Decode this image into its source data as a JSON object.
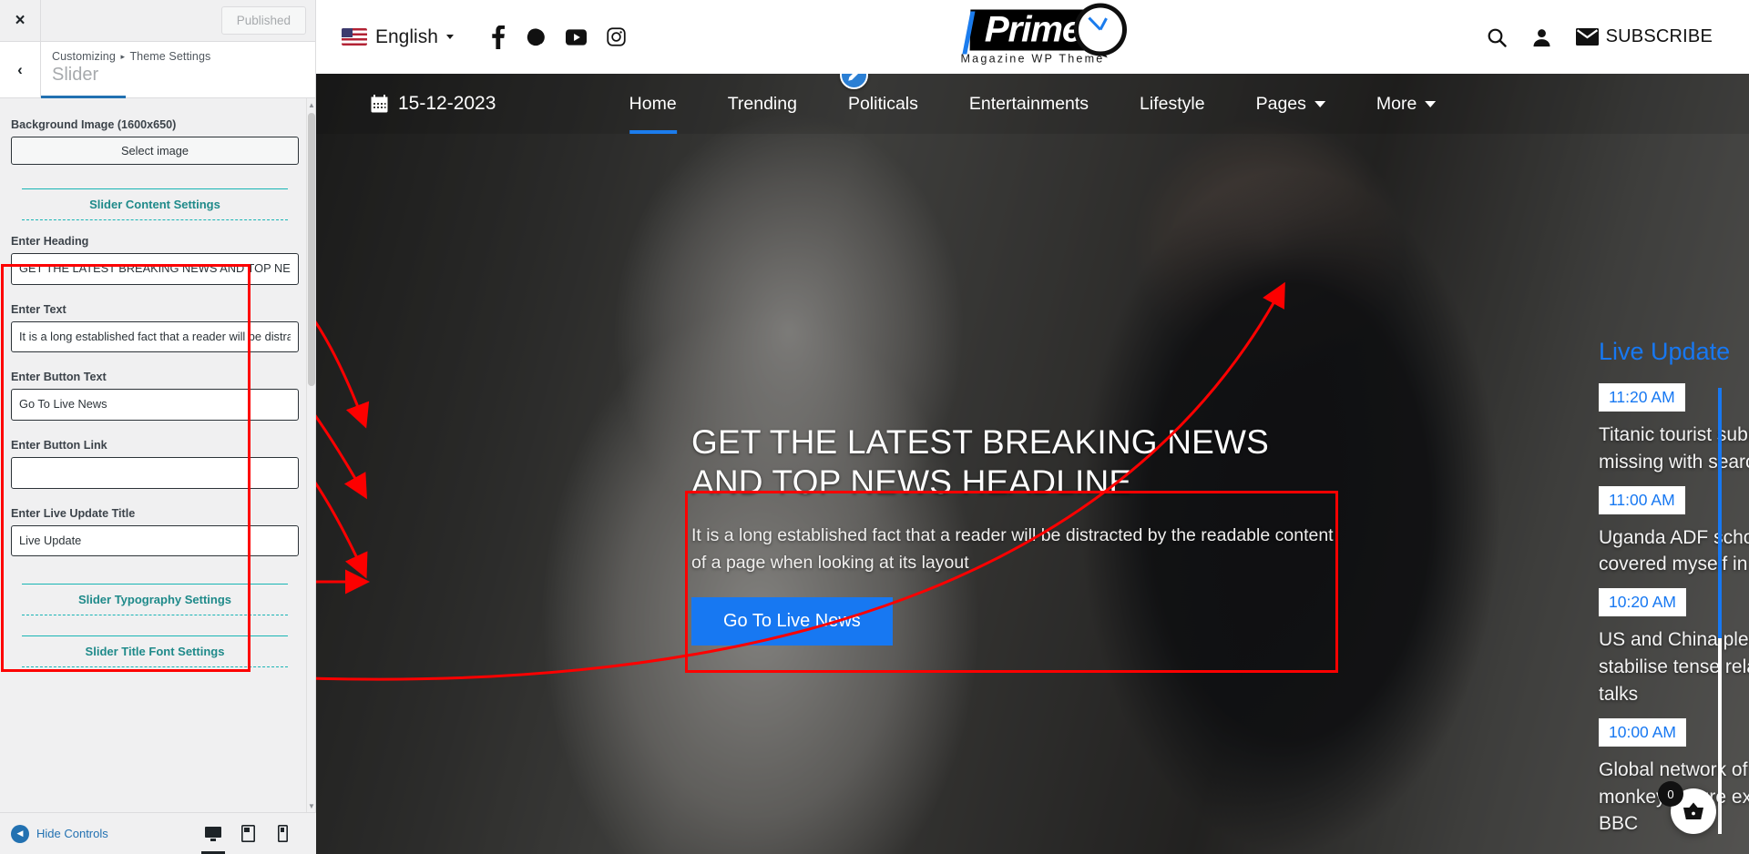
{
  "customizer": {
    "close_label": "×",
    "publish_label": "Published",
    "back_label": "‹",
    "breadcrumb_root": "Customizing",
    "breadcrumb_sep": "▸",
    "breadcrumb_parent": "Theme Settings",
    "panel_title": "Slider",
    "background_image_label": "Background Image (1600x650)",
    "select_image_label": "Select image",
    "sections": {
      "content": "Slider Content Settings",
      "typography": "Slider Typography Settings",
      "title_font": "Slider Title Font Settings"
    },
    "fields": [
      {
        "name": "heading",
        "label": "Enter Heading",
        "value": "GET THE LATEST BREAKING NEWS AND TOP NEWS HEADLINE",
        "placeholder": ""
      },
      {
        "name": "text",
        "label": "Enter Text",
        "value": "It is a long established fact that a reader will be distracted by the readable content of a page when looking at its layout",
        "placeholder": ""
      },
      {
        "name": "button_text",
        "label": "Enter Button Text",
        "value": "Go To Live News",
        "placeholder": ""
      },
      {
        "name": "button_link",
        "label": "Enter Button Link",
        "value": "",
        "placeholder": ""
      },
      {
        "name": "live_update_title",
        "label": "Enter Live Update Title",
        "value": "Live Update",
        "placeholder": ""
      }
    ],
    "footer": {
      "hide_controls_label": "Hide Controls",
      "devices": [
        "desktop-icon",
        "tablet-icon",
        "mobile-icon"
      ],
      "active_device": "desktop-icon"
    },
    "accent_color": "#2271b1",
    "section_color": "#1f8a8a",
    "highlight_color": "#fd0000"
  },
  "site": {
    "language": {
      "label": "English",
      "flag": "us-flag-icon"
    },
    "socials": [
      "facebook-icon",
      "google-icon",
      "youtube-icon",
      "instagram-icon"
    ],
    "logo": {
      "name": "Prime",
      "tagline": "Magazine WP Theme"
    },
    "top_right": {
      "search": "search-icon",
      "account": "user-icon",
      "subscribe_label": "SUBSCRIBE",
      "subscribe_icon": "envelope-icon"
    },
    "nav": {
      "date": "15-12-2023",
      "date_icon": "calendar-icon",
      "items": [
        {
          "label": "Home",
          "active": true,
          "has_caret": false
        },
        {
          "label": "Trending",
          "active": false,
          "has_caret": false
        },
        {
          "label": "Politicals",
          "active": false,
          "has_caret": false
        },
        {
          "label": "Entertainments",
          "active": false,
          "has_caret": false
        },
        {
          "label": "Lifestyle",
          "active": false,
          "has_caret": false
        },
        {
          "label": "Pages",
          "active": false,
          "has_caret": true
        },
        {
          "label": "More",
          "active": false,
          "has_caret": true
        }
      ]
    },
    "slide": {
      "heading": "GET THE LATEST BREAKING NEWS AND TOP NEWS HEADLINE",
      "text": "It is a long established fact that a reader will be distracted by the readable content of a page when looking at its layout",
      "button_label": "Go To Live News",
      "button_color": "#1778f2"
    },
    "live_update": {
      "title": "Live Update",
      "items": [
        {
          "time": "11:20 AM",
          "headline": "Titanic tourist submersible goes missing with search under way"
        },
        {
          "time": "11:00 AM",
          "headline": "Uganda ADF school attack: I covered myself in blood to hide"
        },
        {
          "time": "10:20 AM",
          "headline": "US and China pledge to stabilise tense relationship after talks"
        },
        {
          "time": "10:00 AM",
          "headline": "Global network of sadistic monkey torture exposed by BBC"
        }
      ]
    },
    "cart": {
      "count": "0",
      "icon": "shopping-basket-icon"
    }
  }
}
